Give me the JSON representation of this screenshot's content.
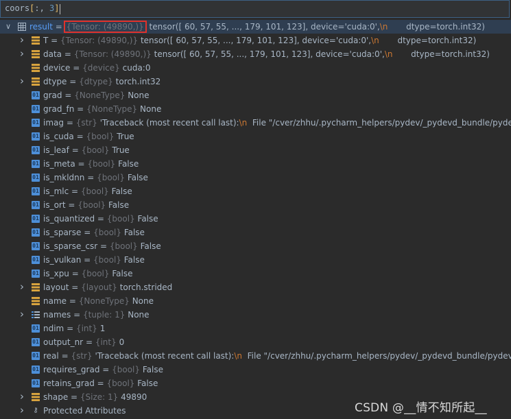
{
  "expression": {
    "var": "coors",
    "open_bracket": "[",
    "slice": ":, ",
    "index": "3",
    "close_bracket": "]"
  },
  "tree": [
    {
      "name": "result",
      "type": "{Tensor: (49890,)}",
      "value": "tensor([ 60,  57,  55,  ..., 179, 101, 123], device='cuda:0',",
      "esc": "\\n",
      "tail": "       dtype=torch.int32)",
      "icon": "table-icon",
      "expand": "open",
      "level": 0,
      "boxed": true,
      "selected": true
    },
    {
      "name": "T",
      "type": "{Tensor: (49890,)}",
      "value": "tensor([ 60,  57,  55,  ..., 179, 101, 123], device='cuda:0',",
      "esc": "\\n",
      "tail": "       dtype=torch.int32)",
      "icon": "stack-icon",
      "expand": "closed",
      "level": 1
    },
    {
      "name": "data",
      "type": "{Tensor: (49890,)}",
      "value": "tensor([ 60,  57,  55,  ..., 179, 101, 123], device='cuda:0',",
      "esc": "\\n",
      "tail": "       dtype=torch.int32)",
      "icon": "stack-icon",
      "expand": "closed",
      "level": 1
    },
    {
      "name": "device",
      "type": "{device}",
      "value": "cuda:0",
      "icon": "stack-icon",
      "expand": "none",
      "level": 1
    },
    {
      "name": "dtype",
      "type": "{dtype}",
      "value": "torch.int32",
      "icon": "stack-icon",
      "expand": "closed",
      "level": 1
    },
    {
      "name": "grad",
      "type": "{NoneType}",
      "value": "None",
      "icon": "field-icon",
      "expand": "none",
      "level": 1
    },
    {
      "name": "grad_fn",
      "type": "{NoneType}",
      "value": "None",
      "icon": "field-icon",
      "expand": "none",
      "level": 1
    },
    {
      "name": "imag",
      "type": "{str}",
      "value": "'Traceback (most recent call last):",
      "esc": "\\n",
      "tail": "  File \"/cver/zhhu/.pycharm_helpers/pydev/_pydevd_bundle/pydevd_re",
      "icon": "field-icon",
      "expand": "none",
      "level": 1
    },
    {
      "name": "is_cuda",
      "type": "{bool}",
      "value": "True",
      "icon": "field-icon",
      "expand": "none",
      "level": 1
    },
    {
      "name": "is_leaf",
      "type": "{bool}",
      "value": "True",
      "icon": "field-icon",
      "expand": "none",
      "level": 1
    },
    {
      "name": "is_meta",
      "type": "{bool}",
      "value": "False",
      "icon": "field-icon",
      "expand": "none",
      "level": 1
    },
    {
      "name": "is_mkldnn",
      "type": "{bool}",
      "value": "False",
      "icon": "field-icon",
      "expand": "none",
      "level": 1
    },
    {
      "name": "is_mlc",
      "type": "{bool}",
      "value": "False",
      "icon": "field-icon",
      "expand": "none",
      "level": 1
    },
    {
      "name": "is_ort",
      "type": "{bool}",
      "value": "False",
      "icon": "field-icon",
      "expand": "none",
      "level": 1
    },
    {
      "name": "is_quantized",
      "type": "{bool}",
      "value": "False",
      "icon": "field-icon",
      "expand": "none",
      "level": 1
    },
    {
      "name": "is_sparse",
      "type": "{bool}",
      "value": "False",
      "icon": "field-icon",
      "expand": "none",
      "level": 1
    },
    {
      "name": "is_sparse_csr",
      "type": "{bool}",
      "value": "False",
      "icon": "field-icon",
      "expand": "none",
      "level": 1
    },
    {
      "name": "is_vulkan",
      "type": "{bool}",
      "value": "False",
      "icon": "field-icon",
      "expand": "none",
      "level": 1
    },
    {
      "name": "is_xpu",
      "type": "{bool}",
      "value": "False",
      "icon": "field-icon",
      "expand": "none",
      "level": 1
    },
    {
      "name": "layout",
      "type": "{layout}",
      "value": "torch.strided",
      "icon": "stack-icon",
      "expand": "closed",
      "level": 1
    },
    {
      "name": "name",
      "type": "{NoneType}",
      "value": "None",
      "icon": "stack-icon",
      "expand": "none",
      "level": 1
    },
    {
      "name": "names",
      "type": "{tuple: 1}",
      "value": "None",
      "icon": "list-icon",
      "expand": "closed",
      "level": 1
    },
    {
      "name": "ndim",
      "type": "{int}",
      "value": "1",
      "icon": "field-icon",
      "expand": "none",
      "level": 1
    },
    {
      "name": "output_nr",
      "type": "{int}",
      "value": "0",
      "icon": "field-icon",
      "expand": "none",
      "level": 1
    },
    {
      "name": "real",
      "type": "{str}",
      "value": "'Traceback (most recent call last):",
      "esc": "\\n",
      "tail": "  File \"/cver/zhhu/.pycharm_helpers/pydev/_pydevd_bundle/pydevd_res",
      "icon": "field-icon",
      "expand": "none",
      "level": 1
    },
    {
      "name": "requires_grad",
      "type": "{bool}",
      "value": "False",
      "icon": "field-icon",
      "expand": "none",
      "level": 1
    },
    {
      "name": "retains_grad",
      "type": "{bool}",
      "value": "False",
      "icon": "field-icon",
      "expand": "none",
      "level": 1
    },
    {
      "name": "shape",
      "type": "{Size: 1}",
      "value": "49890",
      "icon": "stack-icon",
      "expand": "closed",
      "level": 1
    },
    {
      "name": "Protected Attributes",
      "type": "",
      "value": "",
      "icon": "key-icon",
      "expand": "closed",
      "level": 1,
      "plain": true
    }
  ],
  "watermark": "CSDN @__情不知所起__",
  "colors": {
    "background": "#2b2b2b",
    "selection": "#2f3e51",
    "type_gray": "#6f737a",
    "escape_orange": "#cc7832",
    "highlight_box": "#e0322b",
    "result_blue": "#589df6"
  }
}
